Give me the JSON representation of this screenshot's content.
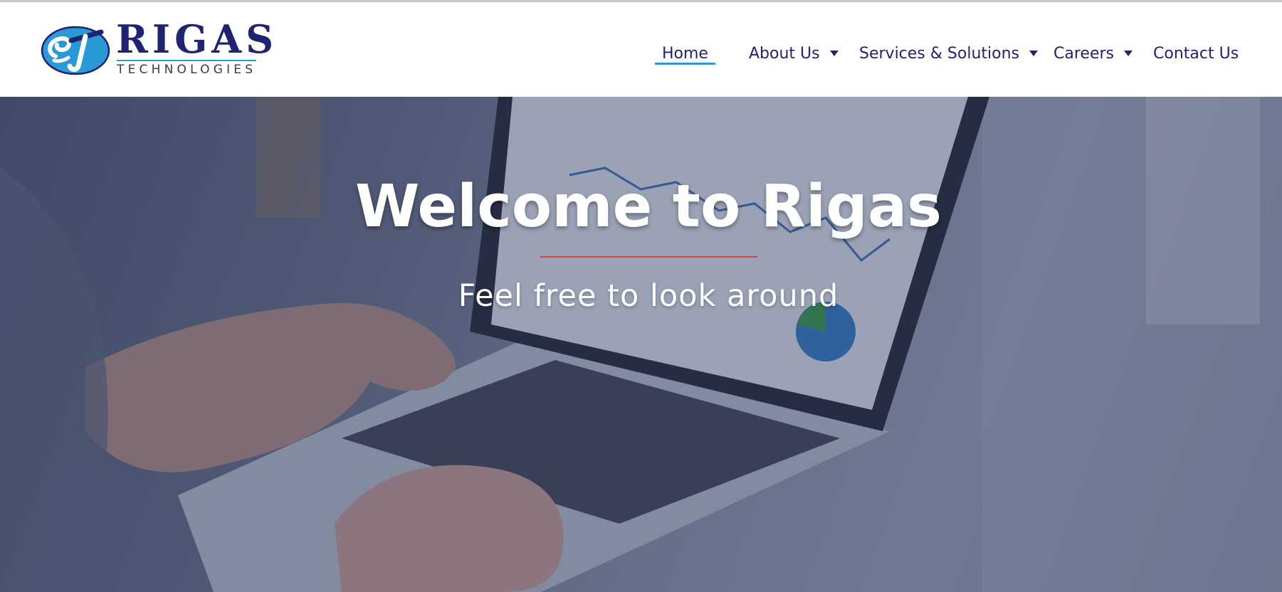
{
  "brand": {
    "name": "RIGAS",
    "tagline": "TECHNOLOGIES",
    "emblem_icon": "rt-monogram-logo",
    "colors": {
      "primary": "#1f2370",
      "accent": "#2a9ad6"
    }
  },
  "nav": {
    "items": [
      {
        "label": "Home",
        "active": true,
        "has_dropdown": false
      },
      {
        "label": "About Us",
        "active": false,
        "has_dropdown": true
      },
      {
        "label": "Services & Solutions",
        "active": false,
        "has_dropdown": true
      },
      {
        "label": "Careers",
        "active": false,
        "has_dropdown": true
      },
      {
        "label": "Contact Us",
        "active": false,
        "has_dropdown": false
      }
    ],
    "dropdown_icon": "caret-down-icon"
  },
  "hero": {
    "title": "Welcome to Rigas",
    "subtitle": "Feel free to look around",
    "background": "laptop-analytics-photo",
    "divider_color": "#d9423b"
  }
}
